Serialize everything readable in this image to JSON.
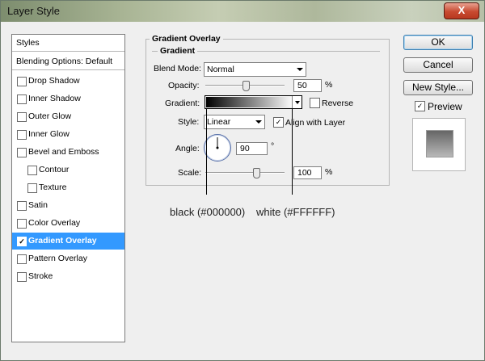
{
  "window": {
    "title": "Layer Style",
    "close_label": "X"
  },
  "styles_panel": {
    "header": "Styles",
    "blending_options": "Blending Options: Default",
    "items": [
      {
        "label": "Drop Shadow",
        "checked": false,
        "selected": false
      },
      {
        "label": "Inner Shadow",
        "checked": false,
        "selected": false
      },
      {
        "label": "Outer Glow",
        "checked": false,
        "selected": false
      },
      {
        "label": "Inner Glow",
        "checked": false,
        "selected": false
      },
      {
        "label": "Bevel and Emboss",
        "checked": false,
        "selected": false
      },
      {
        "label": "Contour",
        "checked": false,
        "selected": false
      },
      {
        "label": "Texture",
        "checked": false,
        "selected": false
      },
      {
        "label": "Satin",
        "checked": false,
        "selected": false
      },
      {
        "label": "Color Overlay",
        "checked": false,
        "selected": false
      },
      {
        "label": "Gradient Overlay",
        "checked": true,
        "selected": true
      },
      {
        "label": "Pattern Overlay",
        "checked": false,
        "selected": false
      },
      {
        "label": "Stroke",
        "checked": false,
        "selected": false
      }
    ]
  },
  "gradient_overlay": {
    "title": "Gradient Overlay",
    "group_title": "Gradient",
    "blend_mode": {
      "label": "Blend Mode:",
      "value": "Normal"
    },
    "opacity": {
      "label": "Opacity:",
      "value": "50",
      "unit": "%",
      "level_percent": 50
    },
    "gradient": {
      "label": "Gradient:",
      "start_color": "#000000",
      "end_color": "#FFFFFF"
    },
    "reverse": {
      "label": "Reverse",
      "checked": false
    },
    "style": {
      "label": "Style:",
      "value": "Linear"
    },
    "align_with_layer": {
      "label": "Align with Layer",
      "checked": true
    },
    "angle": {
      "label": "Angle:",
      "value": "90",
      "unit": "°",
      "degrees": 90
    },
    "scale": {
      "label": "Scale:",
      "value": "100",
      "unit": "%",
      "level_percent": 100
    }
  },
  "annotations": {
    "black": "black (#000000)",
    "white": "white (#FFFFFF)"
  },
  "buttons": {
    "ok": "OK",
    "cancel": "Cancel",
    "new_style": "New Style..."
  },
  "preview": {
    "label": "Preview",
    "checked": true
  },
  "colors": {
    "selection": "#3399ff",
    "dial": "#566fa8"
  },
  "icons": {
    "close": "close-icon",
    "dropdown": "chevron-down-icon",
    "checkbox": "checkbox"
  }
}
